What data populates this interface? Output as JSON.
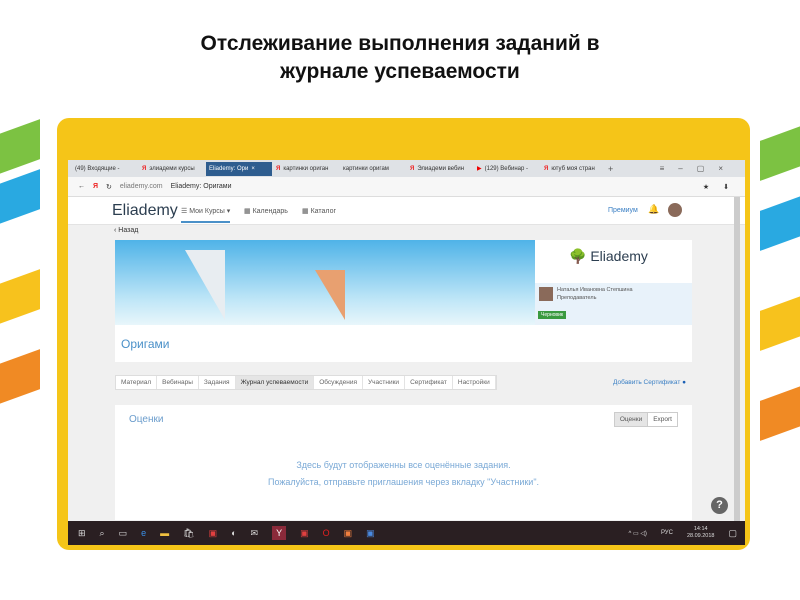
{
  "slide": {
    "title": "Отслеживание выполнения заданий в журнале успеваемости"
  },
  "browser": {
    "tabs": [
      "(49) Входящие -",
      "элиадеми курсы",
      "Eliademy: Ори",
      "картинки ориган",
      "картинки оригам",
      "Элиадеми вебин",
      "(129) Вебинар -",
      "ютуб моя стран"
    ],
    "url_domain": "eliademy.com",
    "page_title": "Eliademy: Оригами"
  },
  "header": {
    "logo": "Eliademy",
    "my_courses": "Мои Курсы",
    "calendar": "Календарь",
    "catalog": "Каталог",
    "premium": "Премиум"
  },
  "back": "Назад",
  "course": {
    "title": "Оригами",
    "brand": "Eliademy",
    "teacher_name": "Наталья Ивановна Степшина",
    "teacher_role": "Преподаватель",
    "draft_badge": "Черновик"
  },
  "course_tabs": [
    "Материал",
    "Вебинары",
    "Задания",
    "Журнал успеваемости",
    "Обсуждения",
    "Участники",
    "Сертификат",
    "Настройки"
  ],
  "add_certificate": "Добавить Сертификат",
  "grades": {
    "title": "Оценки",
    "btn_grades": "Оценки",
    "btn_export": "Export",
    "message_line1": "Здесь будут отображенны все оценённые задания.",
    "message_line2": "Пожалуйста, отправьте приглашения через вкладку \"Участники\"."
  },
  "taskbar": {
    "lang": "РУС",
    "time": "14:14",
    "date": "28.09.2018"
  },
  "help": "?"
}
